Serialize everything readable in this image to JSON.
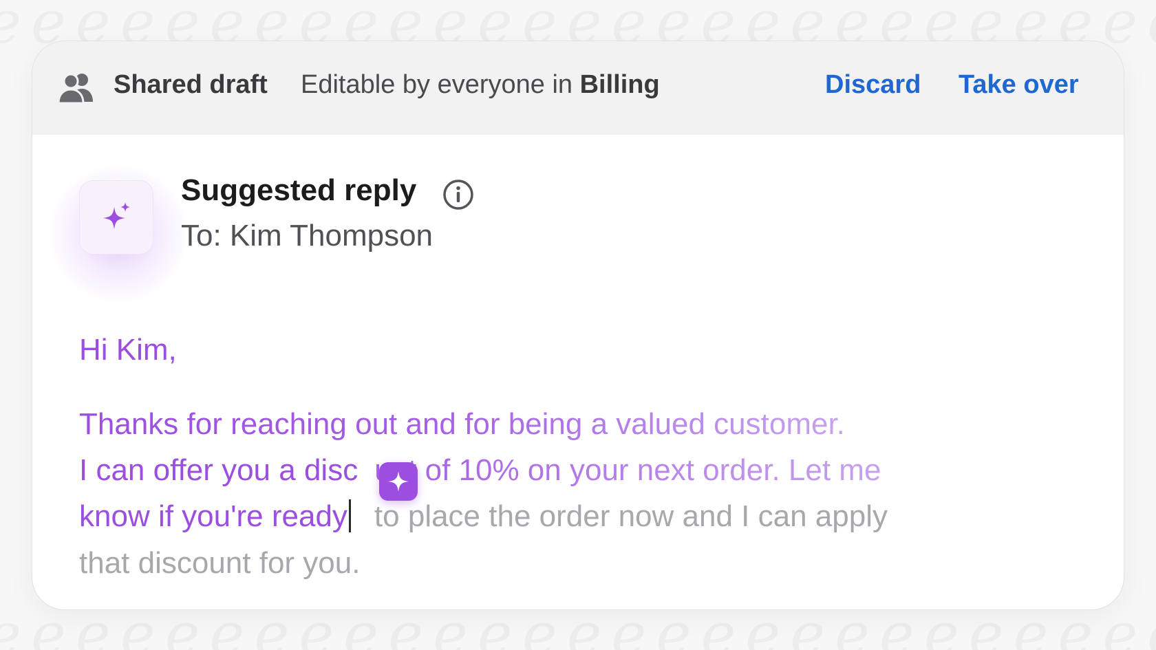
{
  "header": {
    "title": "Shared draft",
    "subtitle_prefix": "Editable by everyone in",
    "team": "Billing",
    "discard_label": "Discard",
    "take_over_label": "Take over",
    "link_color": "#1f68d3",
    "icon": "people-icon"
  },
  "suggestion": {
    "title": "Suggested reply",
    "recipient": "To: Kim Thompson",
    "ai_icon": "sparkles-icon",
    "info_icon": "info-icon",
    "accent_color": "#9b4ee0"
  },
  "message": {
    "greeting": "Hi Kim,",
    "line1": "Thanks for reaching out and for being a valued customer.",
    "line2_a": "I can offer you a disc",
    "line2_b": "unt of 10% on your next order. Let me",
    "line3_typed": "know if you're ready",
    "line3_ghost": "to place the order now and I can apply",
    "line4_ghost": "that discount for you."
  }
}
